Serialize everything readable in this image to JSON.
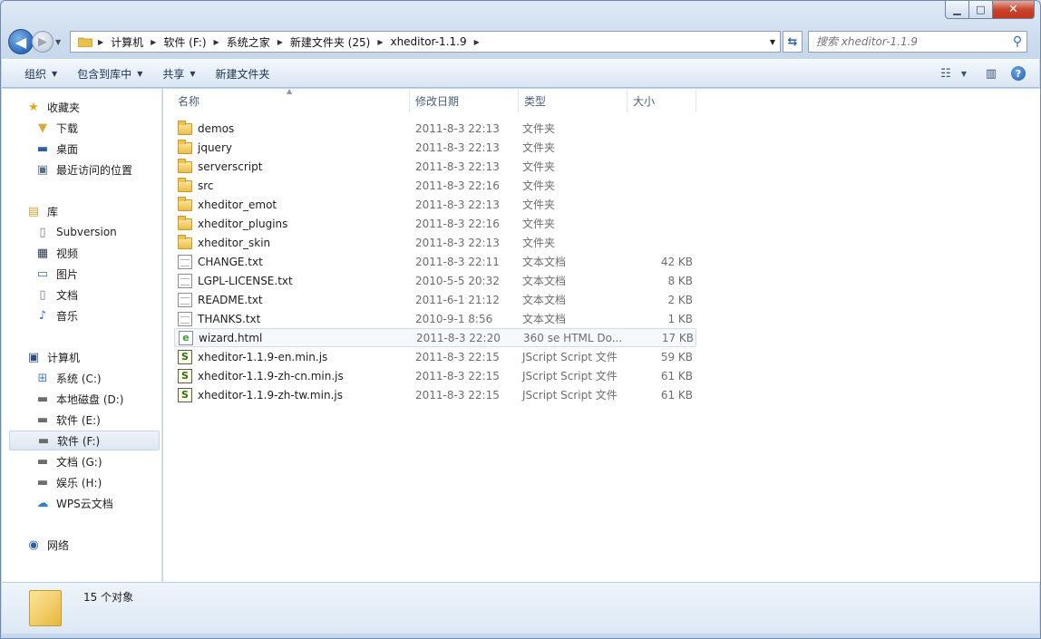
{
  "window": {
    "title": ""
  },
  "caption": {
    "minimize": "▁",
    "maximize": "□",
    "close": "✕"
  },
  "nav": {
    "back_glyph": "◀",
    "forward_glyph": "▶",
    "breadcrumbs": [
      "计算机",
      "软件 (F:)",
      "系统之家",
      "新建文件夹 (25)",
      "xheditor-1.1.9"
    ],
    "search_placeholder": "搜索 xheditor-1.1.9"
  },
  "toolbar": {
    "organize": "组织",
    "include_in_library": "包含到库中",
    "share": "共享",
    "new_folder": "新建文件夹"
  },
  "sidebar": {
    "favorites": {
      "label": "收藏夹",
      "items": [
        "下载",
        "桌面",
        "最近访问的位置"
      ]
    },
    "libraries": {
      "label": "库",
      "items": [
        "Subversion",
        "视频",
        "图片",
        "文档",
        "音乐"
      ]
    },
    "computer": {
      "label": "计算机",
      "items": [
        "系统 (C:)",
        "本地磁盘 (D:)",
        "软件 (E:)",
        "软件 (F:)",
        "文档 (G:)",
        "娱乐 (H:)",
        "WPS云文档"
      ]
    },
    "network": {
      "label": "网络"
    }
  },
  "columns": {
    "name": "名称",
    "modified": "修改日期",
    "type": "类型",
    "size": "大小"
  },
  "files": [
    {
      "name": "demos",
      "modified": "2011-8-3 22:13",
      "type": "文件夹",
      "size": "",
      "icon": "folder"
    },
    {
      "name": "jquery",
      "modified": "2011-8-3 22:13",
      "type": "文件夹",
      "size": "",
      "icon": "folder"
    },
    {
      "name": "serverscript",
      "modified": "2011-8-3 22:13",
      "type": "文件夹",
      "size": "",
      "icon": "folder"
    },
    {
      "name": "src",
      "modified": "2011-8-3 22:16",
      "type": "文件夹",
      "size": "",
      "icon": "folder"
    },
    {
      "name": "xheditor_emot",
      "modified": "2011-8-3 22:13",
      "type": "文件夹",
      "size": "",
      "icon": "folder"
    },
    {
      "name": "xheditor_plugins",
      "modified": "2011-8-3 22:16",
      "type": "文件夹",
      "size": "",
      "icon": "folder"
    },
    {
      "name": "xheditor_skin",
      "modified": "2011-8-3 22:13",
      "type": "文件夹",
      "size": "",
      "icon": "folder"
    },
    {
      "name": "CHANGE.txt",
      "modified": "2011-8-3 22:11",
      "type": "文本文档",
      "size": "42 KB",
      "icon": "text"
    },
    {
      "name": "LGPL-LICENSE.txt",
      "modified": "2010-5-5 20:32",
      "type": "文本文档",
      "size": "8 KB",
      "icon": "text"
    },
    {
      "name": "README.txt",
      "modified": "2011-6-1 21:12",
      "type": "文本文档",
      "size": "2 KB",
      "icon": "text"
    },
    {
      "name": "THANKS.txt",
      "modified": "2010-9-1 8:56",
      "type": "文本文档",
      "size": "1 KB",
      "icon": "text"
    },
    {
      "name": "wizard.html",
      "modified": "2011-8-3 22:20",
      "type": "360 se HTML Do...",
      "size": "17 KB",
      "icon": "html"
    },
    {
      "name": "xheditor-1.1.9-en.min.js",
      "modified": "2011-8-3 22:15",
      "type": "JScript Script 文件",
      "size": "59 KB",
      "icon": "script"
    },
    {
      "name": "xheditor-1.1.9-zh-cn.min.js",
      "modified": "2011-8-3 22:15",
      "type": "JScript Script 文件",
      "size": "61 KB",
      "icon": "script"
    },
    {
      "name": "xheditor-1.1.9-zh-tw.min.js",
      "modified": "2011-8-3 22:15",
      "type": "JScript Script 文件",
      "size": "61 KB",
      "icon": "script"
    }
  ],
  "details": {
    "count_text": "15 个对象"
  }
}
